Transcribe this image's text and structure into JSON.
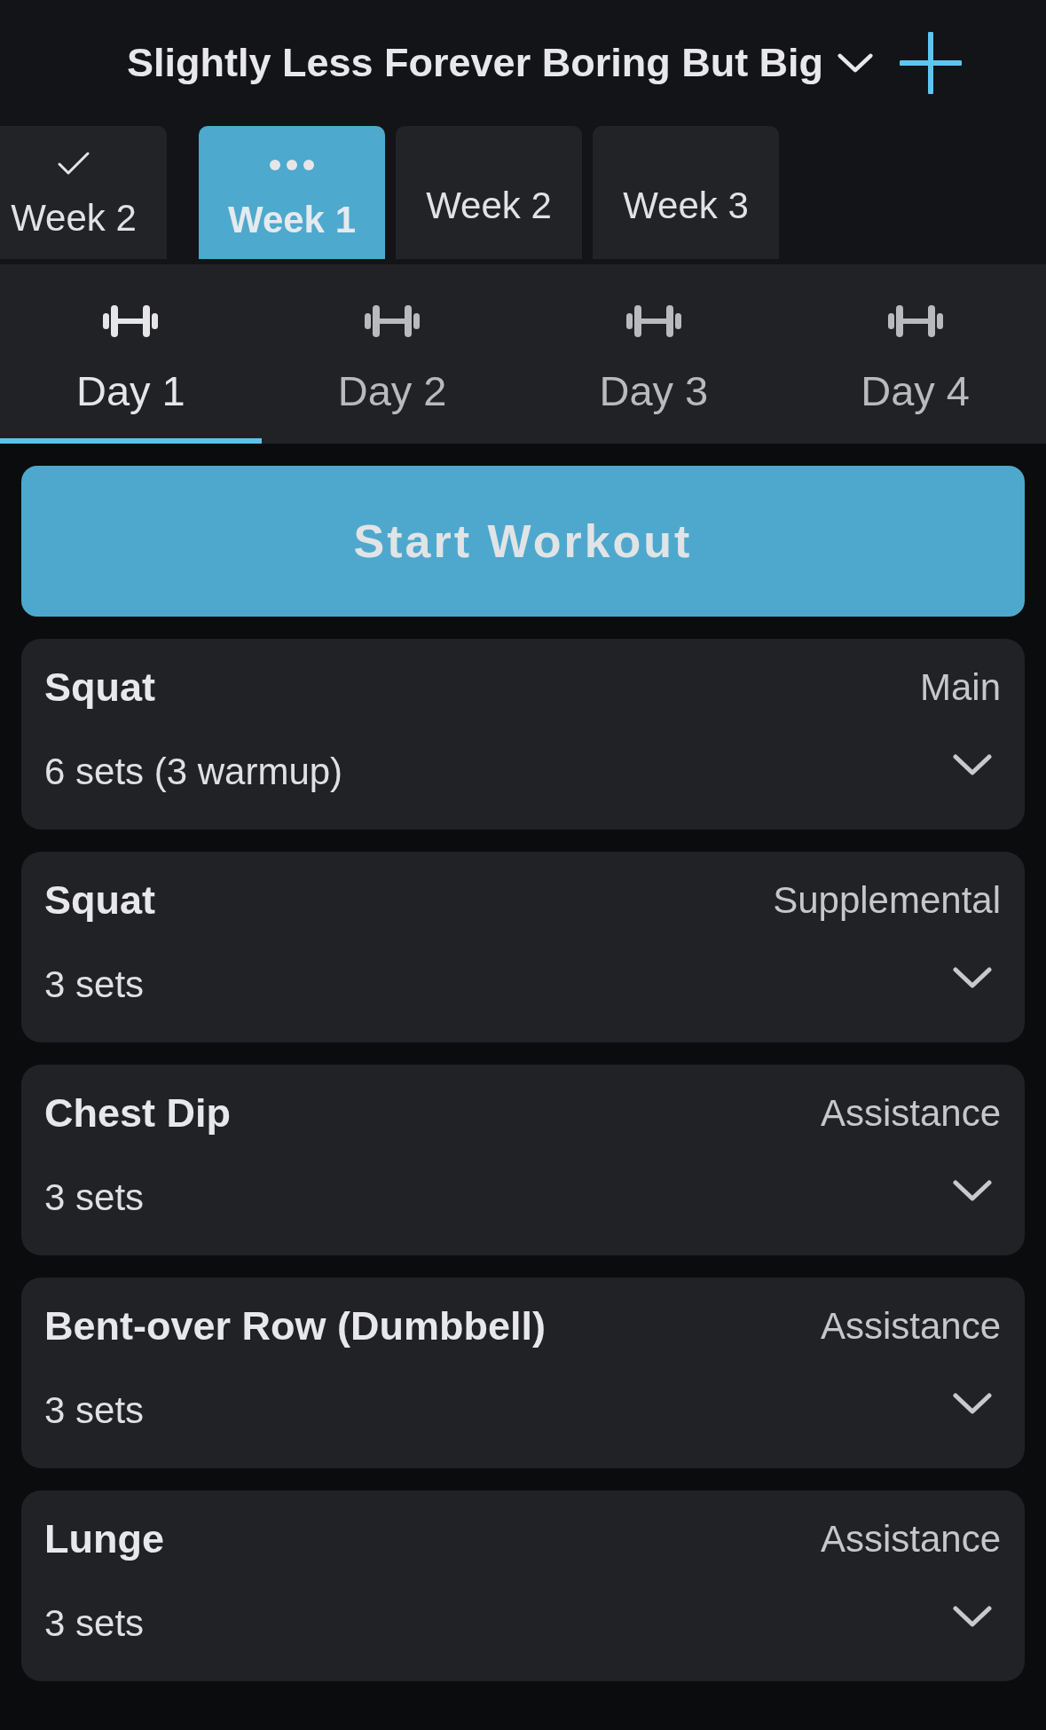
{
  "header": {
    "title": "Slightly Less Forever Boring But Big"
  },
  "weeks": [
    {
      "label": "Week 2",
      "completed": true,
      "in_progress": false,
      "selected": false
    },
    {
      "label": "Week 1",
      "completed": false,
      "in_progress": true,
      "selected": true
    },
    {
      "label": "Week 2",
      "completed": false,
      "in_progress": false,
      "selected": false
    },
    {
      "label": "Week 3",
      "completed": false,
      "in_progress": false,
      "selected": false
    }
  ],
  "days": [
    {
      "label": "Day 1",
      "selected": true
    },
    {
      "label": "Day 2",
      "selected": false
    },
    {
      "label": "Day 3",
      "selected": false
    },
    {
      "label": "Day 4",
      "selected": false
    }
  ],
  "start_button": {
    "label": "Start Workout"
  },
  "exercises": [
    {
      "name": "Squat",
      "category": "Main",
      "sets": "6 sets (3 warmup)",
      "expanded": false
    },
    {
      "name": "Squat",
      "category": "Supplemental",
      "sets": "3 sets",
      "expanded": false
    },
    {
      "name": "Chest Dip",
      "category": "Assistance",
      "sets": "3 sets",
      "expanded": false
    },
    {
      "name": "Bent-over Row (Dumbbell)",
      "category": "Assistance",
      "sets": "3 sets",
      "expanded": false
    },
    {
      "name": "Lunge",
      "category": "Assistance",
      "sets": "3 sets",
      "expanded": false
    }
  ]
}
